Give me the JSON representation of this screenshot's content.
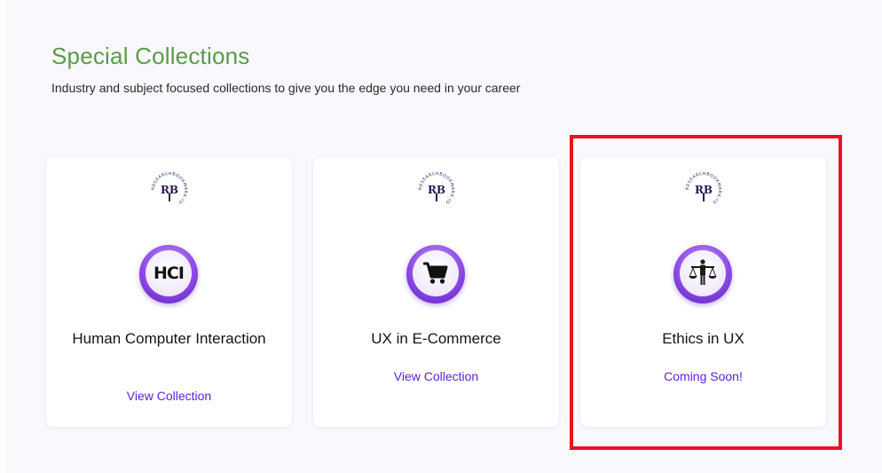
{
  "section": {
    "title": "Special Collections",
    "subtitle": "Industry and subject focused collections to give you the edge you need in your career"
  },
  "brand": {
    "logo_initials": "RB",
    "logo_ring_text": "RESEARCHBOOKMARK.IO",
    "color": "#2a1458"
  },
  "cards": [
    {
      "title": "Human Computer Interaction",
      "icon_text": "HCI",
      "icon": "hci-text-icon",
      "link_label": "View Collection"
    },
    {
      "title": "UX in E-Commerce",
      "icon": "shopping-cart-icon",
      "link_label": "View Collection"
    },
    {
      "title": "Ethics in UX",
      "icon": "justice-scales-icon",
      "link_label": "Coming Soon!"
    }
  ],
  "colors": {
    "title_green": "#5a9a48",
    "link_purple": "#5b1fd6",
    "icon_ring_purple": "#8d4ae6",
    "highlight_red": "#e8151c"
  }
}
